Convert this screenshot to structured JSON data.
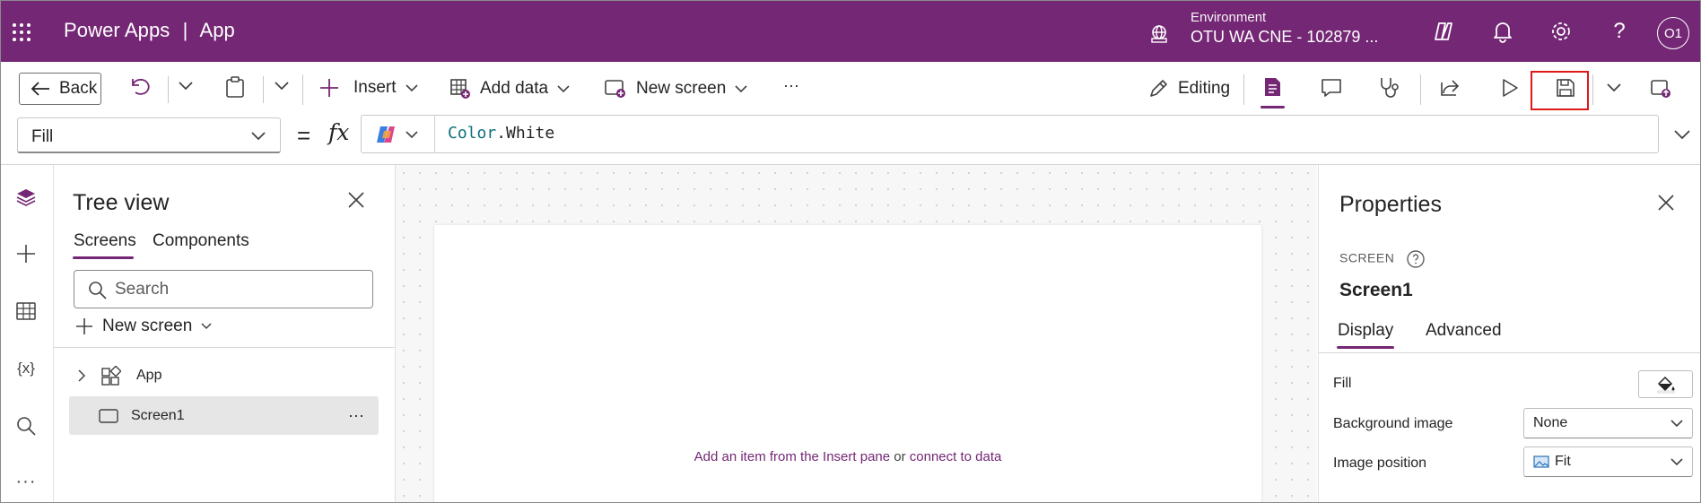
{
  "header": {
    "app_name": "Power Apps",
    "separator": "|",
    "app_section": "App",
    "environment_label": "Environment",
    "environment_value": "OTU WA CNE - 102879 ...",
    "avatar_initials": "O1",
    "brand_color": "#742774"
  },
  "command_bar": {
    "back_label": "Back",
    "insert_label": "Insert",
    "add_data_label": "Add data",
    "new_screen_label": "New screen",
    "more_label": "···",
    "editing_label": "Editing"
  },
  "formula_bar": {
    "property": "Fill",
    "equals": "=",
    "fx": "fx",
    "formula_object": "Color",
    "formula_dot": ".",
    "formula_member": "White"
  },
  "tree_view": {
    "title": "Tree view",
    "tabs": [
      "Screens",
      "Components"
    ],
    "search_placeholder": "Search",
    "new_screen_label": "New screen",
    "items": [
      {
        "label": "App"
      },
      {
        "label": "Screen1"
      }
    ],
    "more_dots": "···"
  },
  "canvas": {
    "hint_part1": "Add an item from the Insert pane",
    "hint_part2": " or ",
    "hint_part3": "connect to data"
  },
  "properties": {
    "title": "Properties",
    "type_label": "SCREEN",
    "screen_name": "Screen1",
    "tabs": [
      "Display",
      "Advanced"
    ],
    "fill_label": "Fill",
    "bg_image_label": "Background image",
    "bg_image_value": "None",
    "image_position_label": "Image position",
    "image_position_value": "Fit"
  }
}
